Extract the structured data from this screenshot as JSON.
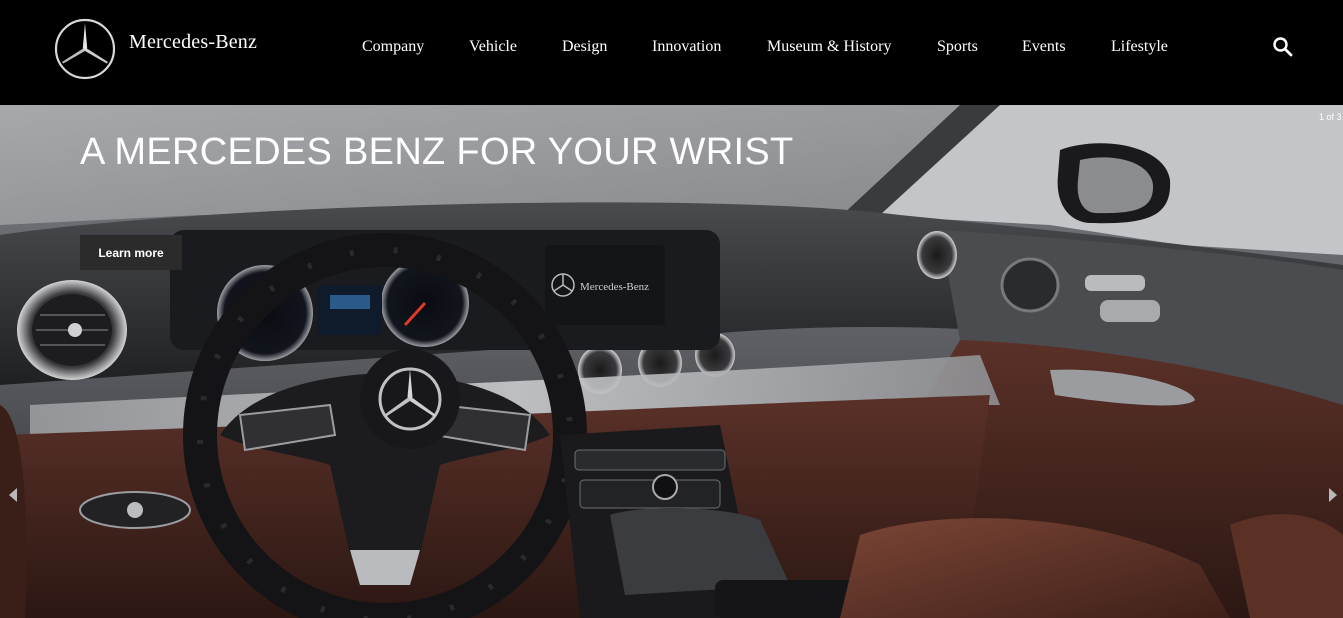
{
  "header": {
    "brand": "Mercedes-Benz",
    "logo_icon": "mercedes-star-icon",
    "search_icon": "search-icon",
    "nav": [
      {
        "label": "Company"
      },
      {
        "label": "Vehicle"
      },
      {
        "label": "Design"
      },
      {
        "label": "Innovation"
      },
      {
        "label": "Museum & History"
      },
      {
        "label": "Sports"
      },
      {
        "label": "Events"
      },
      {
        "label": "Lifestyle"
      }
    ]
  },
  "hero": {
    "title": "A MERCEDES BENZ FOR YOUR WRIST",
    "button_label": "Learn more",
    "slide_counter": "1 of 3",
    "screen_brand": "Mercedes-Benz",
    "prev_icon": "chevron-left-icon",
    "next_icon": "chevron-right-icon"
  },
  "colors": {
    "header_bg": "#000000",
    "button_bg": "#2b2b2b",
    "text": "#ffffff",
    "leather": "#4a2a22"
  }
}
